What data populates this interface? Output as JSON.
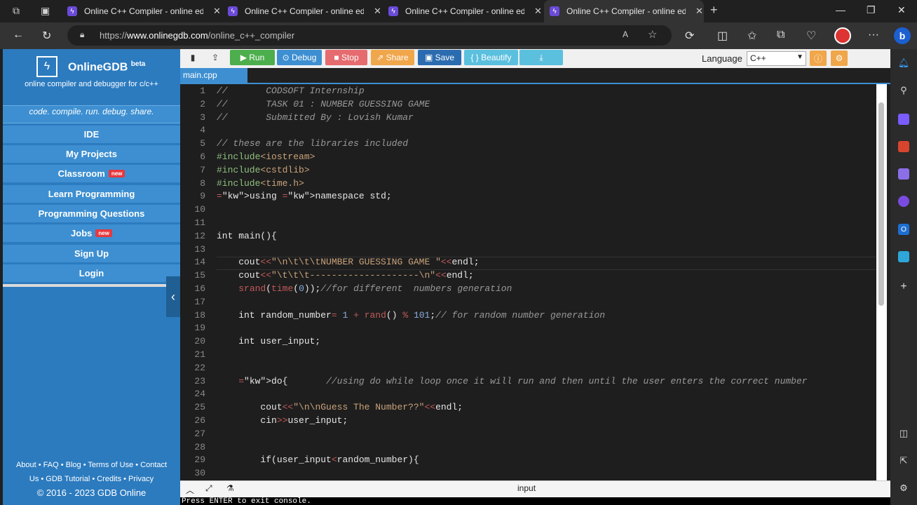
{
  "browser": {
    "tabs": [
      {
        "title": "Online C++ Compiler - online ed",
        "active": false
      },
      {
        "title": "Online C++ Compiler - online ed",
        "active": false
      },
      {
        "title": "Online C++ Compiler - online ed",
        "active": false
      },
      {
        "title": "Online C++ Compiler - online ed",
        "active": true
      }
    ],
    "url_prefix": "https://",
    "url_host": "www.onlinegdb.com",
    "url_path": "/online_c++_compiler",
    "new_tab": "+"
  },
  "site": {
    "brand": "OnlineGDB",
    "brand_sup": "beta",
    "tagline": "online compiler and debugger for c/c++",
    "motto": "code. compile. run. debug. share.",
    "nav": [
      {
        "label": "IDE"
      },
      {
        "label": "My Projects"
      },
      {
        "label": "Classroom",
        "badge": "new"
      },
      {
        "label": "Learn Programming"
      },
      {
        "label": "Programming Questions"
      },
      {
        "label": "Jobs",
        "badge": "new"
      },
      {
        "label": "Sign Up"
      },
      {
        "label": "Login"
      }
    ],
    "footer_line1": "About • FAQ • Blog • Terms of Use • Contact",
    "footer_line2": "Us • GDB Tutorial • Credits • Privacy",
    "footer_line3": "© 2016 - 2023 GDB Online"
  },
  "toolbar": {
    "run": "Run",
    "debug": "Debug",
    "stop": "Stop",
    "share": "Share",
    "save": "Save",
    "beautify": "{ } Beautify",
    "language_label": "Language",
    "language_value": "C++"
  },
  "editor": {
    "file_tab": "main.cpp",
    "line_numbers": [
      "1",
      "2",
      "3",
      "4",
      "5",
      "6",
      "7",
      "8",
      "9",
      "10",
      "11",
      "12",
      "13",
      "14",
      "15",
      "16",
      "17",
      "18",
      "19",
      "20",
      "21",
      "22",
      "23",
      "24",
      "25",
      "26",
      "27",
      "28",
      "29",
      "30"
    ],
    "lines": [
      "//       CODSOFT Internship",
      "//       TASK 01 : NUMBER GUESSING GAME",
      "//       Submitted By : Lovish Kumar",
      "",
      "// these are the libraries included",
      "#include<iostream>",
      "#include<cstdlib>",
      "#include<time.h>",
      "using namespace std;",
      "",
      "",
      "int main(){",
      "",
      "    cout<<\"\\n\\t\\t\\tNUMBER GUESSING GAME \"<<endl;",
      "    cout<<\"\\t\\t\\t--------------------\\n\"<<endl;",
      "    srand(time(0));//for different  numbers generation",
      "",
      "    int random_number= 1 + rand() % 101;// for random number generation",
      "",
      "    int user_input;",
      "",
      "",
      "    do{       //using do while loop once it will run and then until the user enters the correct number",
      "",
      "        cout<<\"\\n\\nGuess The Number??\"<<endl;",
      "        cin>>user_input;",
      "",
      "",
      "        if(user_input<random_number){",
      ""
    ],
    "bottom_label": "input",
    "console_text": "Press ENTER to exit console."
  }
}
